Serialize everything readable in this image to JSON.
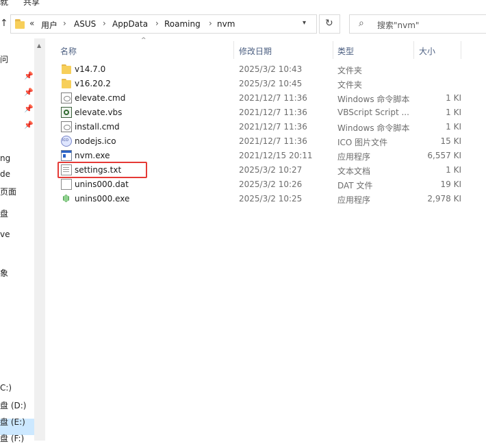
{
  "ribbon": {
    "tab_left": "就",
    "tab_share": "共享"
  },
  "address": {
    "overflow": "«",
    "crumbs": [
      "用户",
      "ASUS",
      "AppData",
      "Roaming",
      "nvm"
    ],
    "separator": "›"
  },
  "search": {
    "placeholder": "搜索\"nvm\""
  },
  "sidebar": {
    "items": [
      "问",
      "ng",
      "de",
      "页面",
      "盘",
      "ve",
      "象",
      "C:)",
      "盘 (D:)",
      "盘 (E:)",
      "盘 (F:)"
    ]
  },
  "columns": {
    "name": "名称",
    "date": "修改日期",
    "type": "类型",
    "size": "大小"
  },
  "files": [
    {
      "name": "v14.7.0",
      "date": "2025/3/2 10:43",
      "type": "文件夹",
      "size": "",
      "icon": "folder-icon"
    },
    {
      "name": "v16.20.2",
      "date": "2025/3/2 10:45",
      "type": "文件夹",
      "size": "",
      "icon": "folder-icon"
    },
    {
      "name": "elevate.cmd",
      "date": "2021/12/7 11:36",
      "type": "Windows 命令脚本",
      "size": "1 KI",
      "icon": "cmd-file-icon"
    },
    {
      "name": "elevate.vbs",
      "date": "2021/12/7 11:36",
      "type": "VBScript Script ...",
      "size": "1 KI",
      "icon": "vbs-file-icon"
    },
    {
      "name": "install.cmd",
      "date": "2021/12/7 11:36",
      "type": "Windows 命令脚本",
      "size": "1 KI",
      "icon": "cmd-file-icon"
    },
    {
      "name": "nodejs.ico",
      "date": "2021/12/7 11:36",
      "type": "ICO 图片文件",
      "size": "15 KI",
      "icon": "ico-file-icon"
    },
    {
      "name": "nvm.exe",
      "date": "2021/12/15 20:11",
      "type": "应用程序",
      "size": "6,557 KI",
      "icon": "exe-file-icon"
    },
    {
      "name": "settings.txt",
      "date": "2025/3/2 10:27",
      "type": "文本文档",
      "size": "1 KI",
      "icon": "txt-file-icon"
    },
    {
      "name": "unins000.dat",
      "date": "2025/3/2 10:26",
      "type": "DAT 文件",
      "size": "19 KI",
      "icon": "dat-file-icon"
    },
    {
      "name": "unins000.exe",
      "date": "2025/3/2 10:25",
      "type": "应用程序",
      "size": "2,978 KI",
      "icon": "uninstaller-exe-icon"
    }
  ],
  "highlight_color": "#e53935",
  "selection_color": "#cce8ff"
}
